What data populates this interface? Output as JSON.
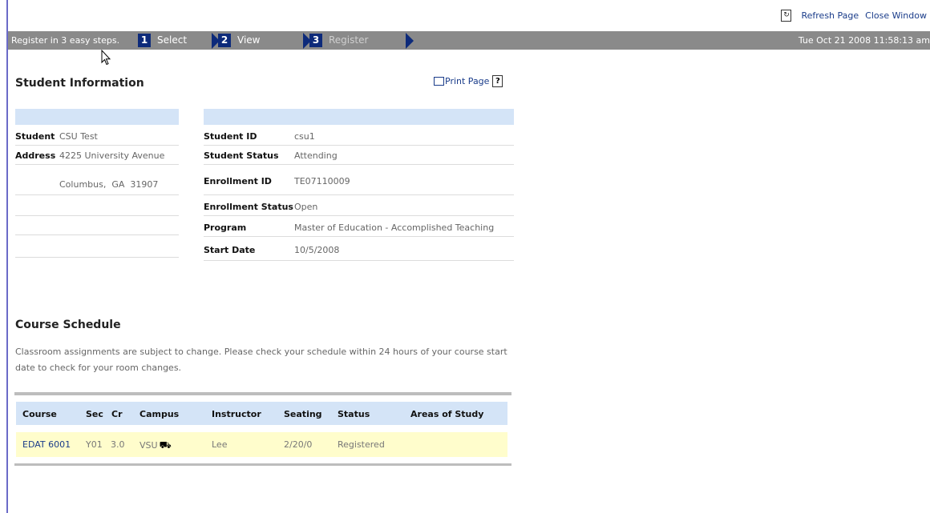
{
  "toplinks": {
    "refresh": "Refresh Page",
    "close": "Close Window"
  },
  "stepbar": {
    "intro": "Register in 3 easy steps.",
    "steps": [
      {
        "num": "1",
        "label": "Select"
      },
      {
        "num": "2",
        "label": "View"
      },
      {
        "num": "3",
        "label": "Register"
      }
    ],
    "datetime": "Tue Oct 21 2008 11:58:13 am"
  },
  "student_info": {
    "title": "Student Information",
    "print": "Print Page",
    "help": "?",
    "left": [
      {
        "key": "Student",
        "value": "CSU Test"
      },
      {
        "key": "Address",
        "value": "4225 University Avenue"
      },
      {
        "key": "",
        "value": "Columbus,  GA  31907"
      }
    ],
    "right": [
      {
        "key": "Student ID",
        "value": "csu1"
      },
      {
        "key": "Student Status",
        "value": "Attending"
      },
      {
        "key": "Enrollment ID",
        "value": "TE07110009"
      },
      {
        "key": "Enrollment Status",
        "value": "Open"
      },
      {
        "key": "Program",
        "value": "Master of Education - Accomplished Teaching"
      },
      {
        "key": "Start Date",
        "value": "10/5/2008"
      }
    ]
  },
  "course_schedule": {
    "title": "Course Schedule",
    "note": "Classroom assignments are subject to change. Please check your schedule within 24 hours of your course start date to check for your room changes.",
    "columns": [
      "Course",
      "Sec",
      "Cr",
      "Campus",
      "Instructor",
      "Seating",
      "Status",
      "Areas of Study"
    ],
    "rows": [
      {
        "course": "EDAT 6001",
        "sec": "Y01",
        "cr": "3.0",
        "campus": "VSU",
        "instructor": "Lee",
        "seating": "2/20/0",
        "status": "Registered",
        "areas": ""
      }
    ]
  },
  "icons": {
    "refresh": "refresh-icon",
    "print": "printer-icon",
    "help": "help-icon",
    "campus": "car-icon",
    "cursor": "mouse-cursor-icon"
  }
}
